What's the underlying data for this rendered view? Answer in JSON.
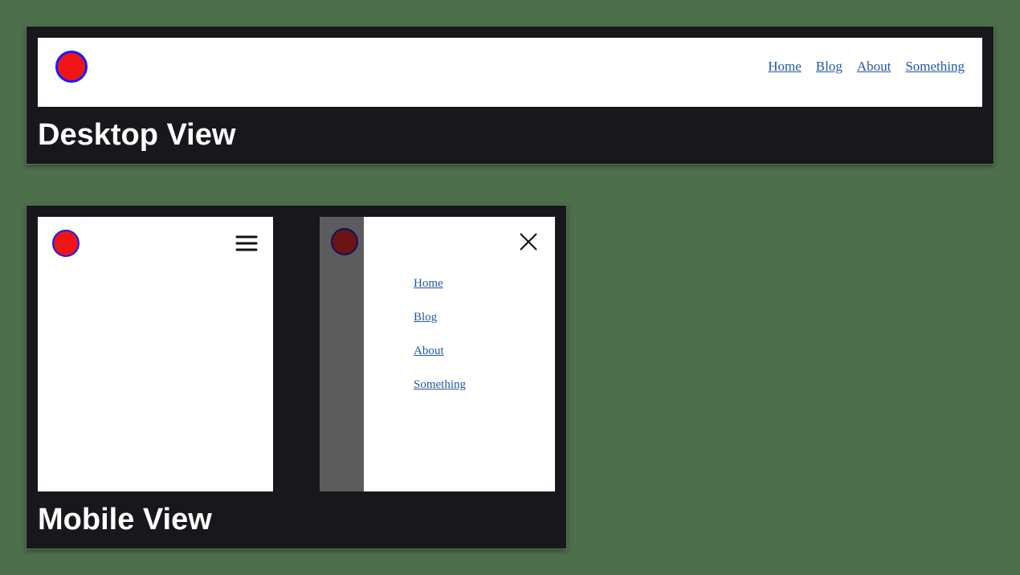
{
  "nav": {
    "items": [
      {
        "label": "Home"
      },
      {
        "label": "Blog"
      },
      {
        "label": "About"
      },
      {
        "label": "Something"
      }
    ]
  },
  "sections": {
    "desktop_title": "Desktop View",
    "mobile_title": "Mobile View"
  }
}
